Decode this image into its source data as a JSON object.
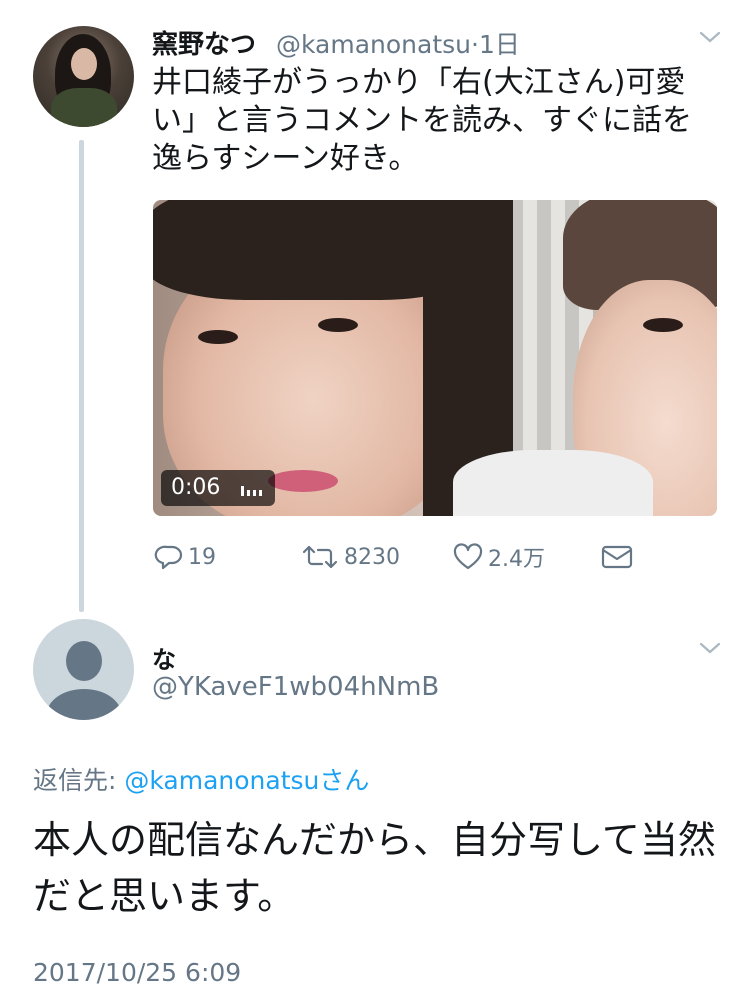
{
  "tweet1": {
    "author_name": "窯野なつ",
    "handle": "@kamanonatsu",
    "separator": "·",
    "time": "1日",
    "text": "井口綾子がうっかり「右(大江さん)可愛い」と言うコメントを読み、すぐに話を逸らすシーン好き。",
    "video_duration": "0:06",
    "actions": {
      "reply_count": "19",
      "retweet_count": "8230",
      "like_count": "2.4万"
    },
    "icons": [
      "reply-icon",
      "retweet-icon",
      "like-icon",
      "message-icon",
      "chevron-down-icon",
      "audio-bars-icon"
    ]
  },
  "tweet2": {
    "author_name": "な",
    "handle": "@YKaveF1wb04hNmB",
    "reply_to_prefix": "返信先: ",
    "reply_to_mention": "@kamanonatsuさん",
    "text": "本人の配信なんだから、自分写して当然だと思います。",
    "timestamp": "2017/10/25 6:09"
  },
  "colors": {
    "text": "#14171a",
    "secondary": "#657786",
    "link": "#1da1f2",
    "thread_line": "#ccd6dd"
  }
}
